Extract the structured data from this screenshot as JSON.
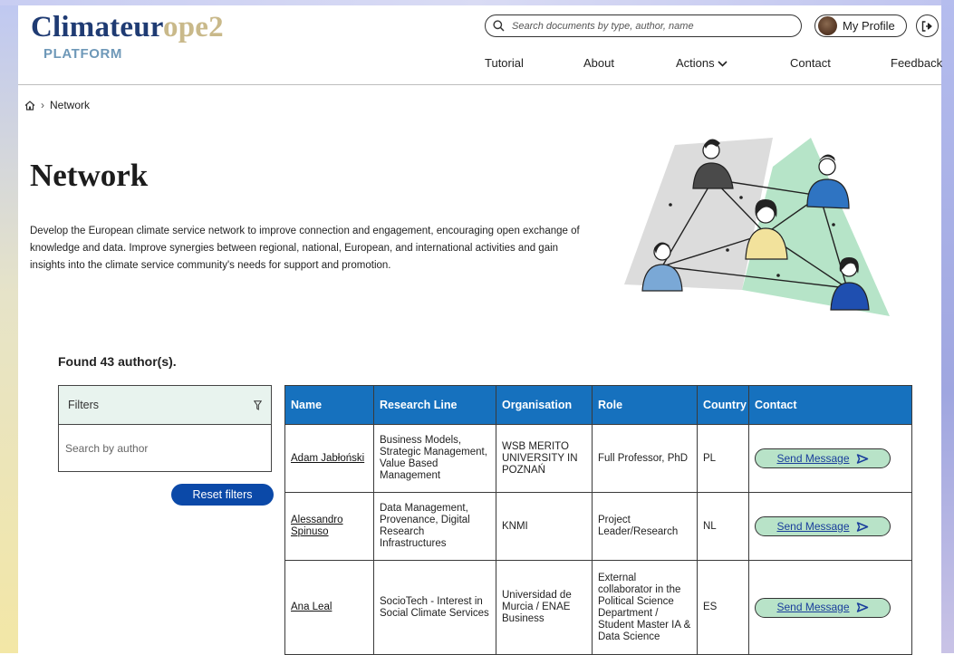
{
  "header": {
    "logo_part1": "Climateur",
    "logo_part2": "ope2",
    "logo_subtitle": "PLATFORM",
    "search_placeholder": "Search documents by type, author, name",
    "profile_label": "My Profile",
    "nav": [
      "Tutorial",
      "About",
      "Actions",
      "Contact",
      "Feedback"
    ]
  },
  "breadcrumb": {
    "current": "Network"
  },
  "main": {
    "title": "Network",
    "intro": "Develop the European climate service network to improve connection and engagement, encouraging open exchange of knowledge and data. Improve synergies between regional, national, European, and international activities and gain insights into the climate service community's needs for support and promotion.",
    "found_text": "Found 43 author(s)."
  },
  "filters": {
    "title": "Filters",
    "search_placeholder": "Search by author",
    "reset_label": "Reset filters"
  },
  "table": {
    "columns": [
      "Name",
      "Research Line",
      "Organisation",
      "Role",
      "Country",
      "Contact"
    ],
    "rows": [
      {
        "name": "Adam Jabłoński",
        "research_line": "Business Models, Strategic Management, Value Based Management",
        "organisation": "WSB MERITO UNIVERSITY IN POZNAŃ",
        "role": "Full Professor, PhD",
        "country": "PL",
        "contact": "Send Message"
      },
      {
        "name": "Alessandro Spinuso",
        "research_line": "Data Management, Provenance, Digital Research Infrastructures",
        "organisation": "KNMI",
        "role": "Project Leader/Research",
        "country": "NL",
        "contact": "Send Message"
      },
      {
        "name": "Ana Leal",
        "research_line": "SocioTech - Interest in Social Climate Services",
        "organisation": "Universidad de Murcia / ENAE Business",
        "role": "External collaborator in the Political Science Department / Student Master IA & Data Science",
        "country": "ES",
        "contact": "Send Message"
      }
    ]
  },
  "colors": {
    "logo_dark": "#1f3b73",
    "logo_light": "#c9b98a",
    "table_header": "#1671be",
    "reset_button": "#0b49a8",
    "send_button": "#b8e3c8",
    "filter_header": "#e8f3ee"
  },
  "icons": [
    "home-icon",
    "search-icon",
    "logout-icon",
    "chevron-down-icon",
    "filter-icon",
    "send-icon"
  ]
}
